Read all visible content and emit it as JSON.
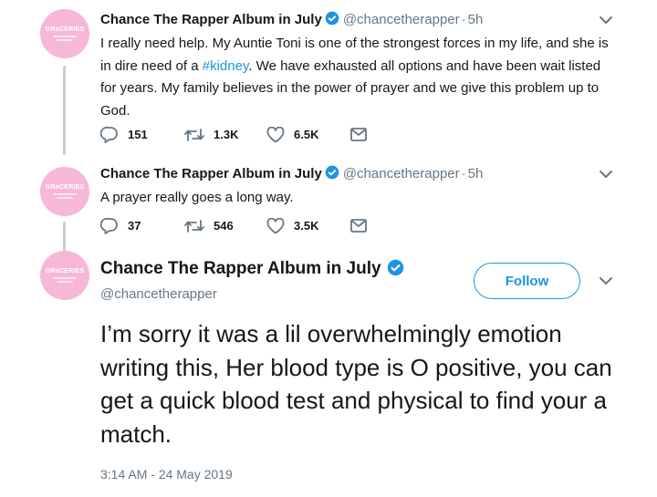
{
  "tweets": [
    {
      "avatar_text": "GRoCERIES",
      "name": "Chance The Rapper Album in July",
      "handle": "@chancetherapper",
      "time": "5h",
      "text_before": "I really need help. My Auntie Toni is one of the strongest forces in my life, and she is in dire need of a ",
      "hashtag": "#kidney",
      "text_after": ". We have exhausted all options and have been wait listed for years. My family believes in the power of prayer and we give this problem up to God.",
      "replies": "151",
      "retweets": "1.3K",
      "likes": "6.5K"
    },
    {
      "avatar_text": "GRoCERIES",
      "name": "Chance The Rapper Album in July",
      "handle": "@chancetherapper",
      "time": "5h",
      "text": "A prayer really goes a long way.",
      "replies": "37",
      "retweets": "546",
      "likes": "3.5K"
    }
  ],
  "main_tweet": {
    "avatar_text": "GRoCERIES",
    "name": "Chance The Rapper Album in July",
    "handle": "@chancetherapper",
    "follow_label": "Follow",
    "text": "I’m sorry it was a lil overwhelmingly emotion writing this, Her blood type is O positive, you can get a quick blood test and physical to find your a match.",
    "timestamp": "3:14 AM - 24 May 2019"
  },
  "colors": {
    "accent": "#1b95e0",
    "avatar_pink": "#f6b8d6",
    "muted": "#657786",
    "thread_line": "#c4cfd6"
  },
  "icons": [
    "verified-badge-icon",
    "chevron-down-icon",
    "reply-icon",
    "retweet-icon",
    "like-icon",
    "direct-message-icon"
  ]
}
